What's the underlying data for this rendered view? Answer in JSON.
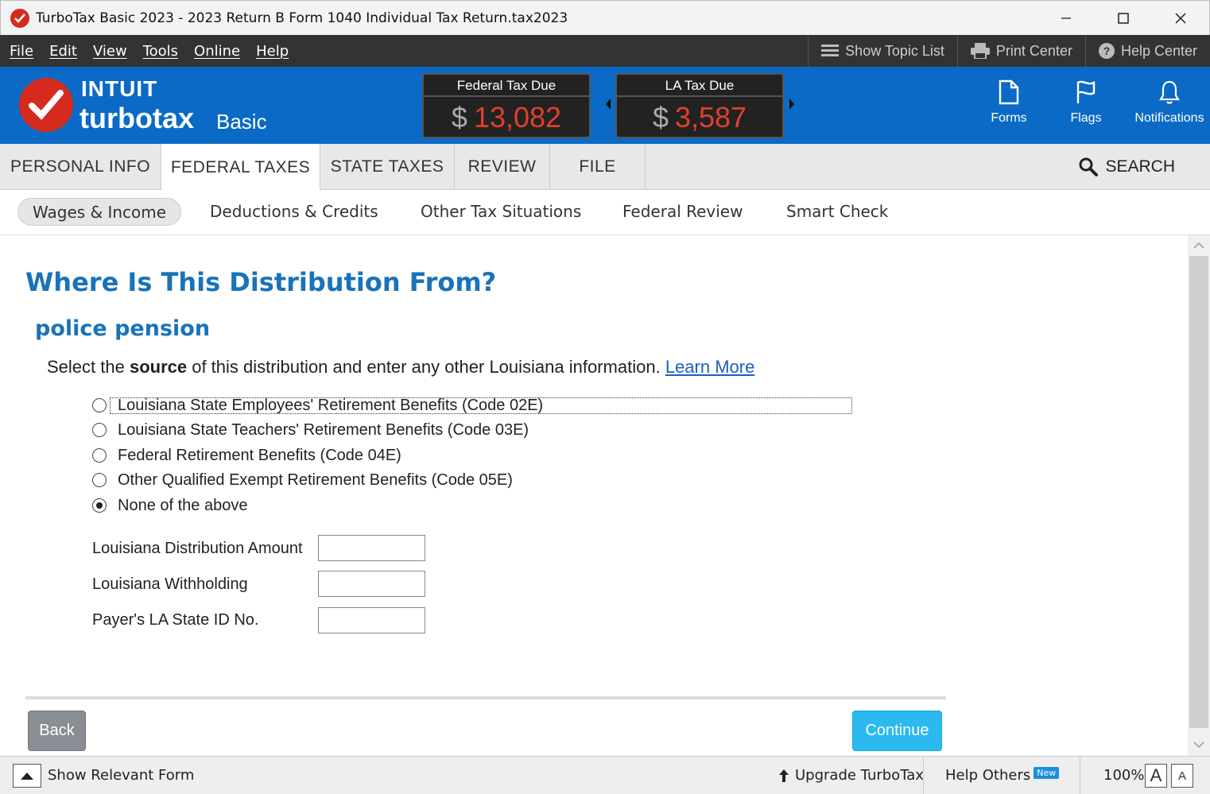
{
  "window": {
    "title": "TurboTax Basic 2023 - 2023 Return B Form 1040  Individual Tax Return.tax2023"
  },
  "menu": {
    "items": [
      "File",
      "Edit",
      "View",
      "Tools",
      "Online",
      "Help"
    ],
    "show_topic_list": "Show Topic List",
    "print_center": "Print Center",
    "help_center": "Help Center"
  },
  "header": {
    "brand_intuit": "INTUIT",
    "brand_turbotax": "turbotax",
    "brand_edition": "Basic",
    "federal": {
      "label": "Federal Tax Due",
      "currency": "$",
      "amount": "13,082"
    },
    "state": {
      "label": "LA Tax Due",
      "currency": "$",
      "amount": "3,587"
    },
    "forms_label": "Forms",
    "flags_label": "Flags",
    "notifications_label": "Notifications"
  },
  "tabs": {
    "items": [
      "PERSONAL INFO",
      "FEDERAL TAXES",
      "STATE TAXES",
      "REVIEW",
      "FILE"
    ],
    "active": "FEDERAL TAXES",
    "search_label": "SEARCH"
  },
  "subtabs": {
    "items": [
      "Wages & Income",
      "Deductions & Credits",
      "Other Tax Situations",
      "Federal Review",
      "Smart Check"
    ],
    "active": "Wages & Income"
  },
  "page": {
    "title": "Where Is This Distribution From?",
    "subtitle": "police pension",
    "instruction_pre": "Select the ",
    "instruction_bold": "source",
    "instruction_post": " of this distribution and enter any other Louisiana information. ",
    "learn_more": "Learn More",
    "options": [
      "Louisiana State Employees' Retirement Benefits (Code 02E)",
      "Louisiana State Teachers' Retirement Benefits (Code 03E)",
      "Federal Retirement Benefits (Code 04E)",
      "Other Qualified Exempt Retirement Benefits (Code 05E)",
      "None of the above"
    ],
    "selected_option": "None of the above",
    "fields": {
      "distribution_amount": {
        "label": "Louisiana Distribution Amount",
        "value": ""
      },
      "withholding": {
        "label": "Louisiana Withholding",
        "value": ""
      },
      "payer_id": {
        "label": "Payer's LA State ID No.",
        "value": ""
      }
    },
    "back_label": "Back",
    "continue_label": "Continue"
  },
  "statusbar": {
    "show_relevant_form": "Show Relevant Form",
    "upgrade": "Upgrade TurboTax",
    "help_others": "Help Others",
    "new_badge": "New",
    "zoom": "100%",
    "font_large": "A",
    "font_small": "A"
  },
  "colors": {
    "header_blue": "#0a6ac5",
    "brand_red": "#d52b1e",
    "title_blue": "#1a73b8",
    "continue_blue": "#2bb9f0",
    "tax_due_red": "#e0402c"
  }
}
